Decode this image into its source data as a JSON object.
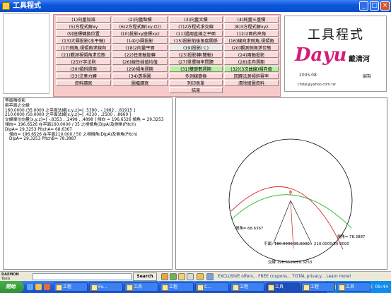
{
  "window": {
    "title": "工具程式"
  },
  "menu": {
    "rows": [
      [
        "(1)向量加減",
        "(2)向量點積",
        "(3)向量叉積",
        "(4)純量三重積"
      ],
      [
        "(5)方程式解xy",
        "(6)2方程式解(xy,(t))",
        "(7)2方程式求交線",
        "(8)3方程式解xyz"
      ],
      [
        "(9)座標轉換位置",
        "(10)投影xy座標xyz",
        "(11)過兩直線之平面",
        "(12)2面的夾角"
      ],
      [
        "(13)大圓投影(水平軸)",
        "(14)小圓投影",
        "(15)投影前後角度關係",
        "(16)線向求側角,視傾角"
      ],
      [
        "(17)側角,視傾角求線向",
        "(18)2向量平面",
        "(19)投影(ㄑ)",
        "(20)觀測側角求位態"
      ],
      [
        "(21)觀測視傾角求位態",
        "(22)任意軸旋轉",
        "(23)投影轉(雙軸)",
        "(24)兩軸投影"
      ],
      [
        "(25)Y字法則",
        "(26)線性插值均值",
        "(27)單擺頻率問題",
        "(28)走向週期"
      ],
      [
        "(30)傾斜週期",
        "(29)傾角週期",
        "(31)雙變數週期",
        "(32)(3次曲線)傾向值"
      ],
      [
        "(33)注意力轉",
        "(34)透視圖",
        "多測線變換",
        "回歸法測傾斜幂率"
      ],
      [
        "資料讀寫",
        "圖檔讀寫",
        "列印表單",
        "清除繪圖資料"
      ]
    ],
    "end_label": "結束"
  },
  "logo": {
    "title": "工具程式",
    "word": "Dayu",
    "author": "戴清河",
    "role": "編製",
    "year": "2005.08",
    "email": "chdai@yahoo.com.tw"
  },
  "results": {
    "lines": [
      "等面積投影",
      "兩平面之交線",
      "160.0000 /35.0000 之平面法線[x,y,z]=[ .5390 , -.1962 , .81915 ]",
      "210.0000 /50.0000 之平面法線[x,y,z]=[ .4330 , .2500 , .8660 ]",
      "交線單位向量[x,y,z]=[ -.8353 , .2498 , .4898 ] 傾向 = 196.6526 傾角 = 29.3253",
      "傾向= 196.6526 在平面160.0000 / 35 之視傾角(DipA)及側角(Pitch)",
      "DipA= 29.3253 PitchA= 68.6367",
      "傾向= 196.6526 在平面210.000 / 50 之視傾角(DipA)及側角(Pitch)",
      "DipA= 29.3253 PitchB= 78.3887"
    ]
  },
  "plot": {
    "label_pitch_a": "側角= 68.6367",
    "label_pitch_b": "側角= 78.3887",
    "label_plane_a": "160.0000/35.0000",
    "label_plane_b": "210.0000/50.0000",
    "label_line": "交線 196.6526/29.3253",
    "label_plane_prefix": "平面)",
    "north_mark": "N"
  },
  "toolbar": {
    "brand_line1": "DAEMON",
    "brand_line2": "Tools",
    "search_label": "Search",
    "ad_text": "EXCLUSIVE offers... FREE coupons... TOTAL privacy... Learn more!"
  },
  "taskbar": {
    "start_label": "開始",
    "tasks": [
      "工程",
      "Fo...",
      "工具",
      "工程",
      "C...",
      "工程",
      "工具",
      "工程",
      "工具"
    ],
    "clock": "下午 09:44"
  }
}
